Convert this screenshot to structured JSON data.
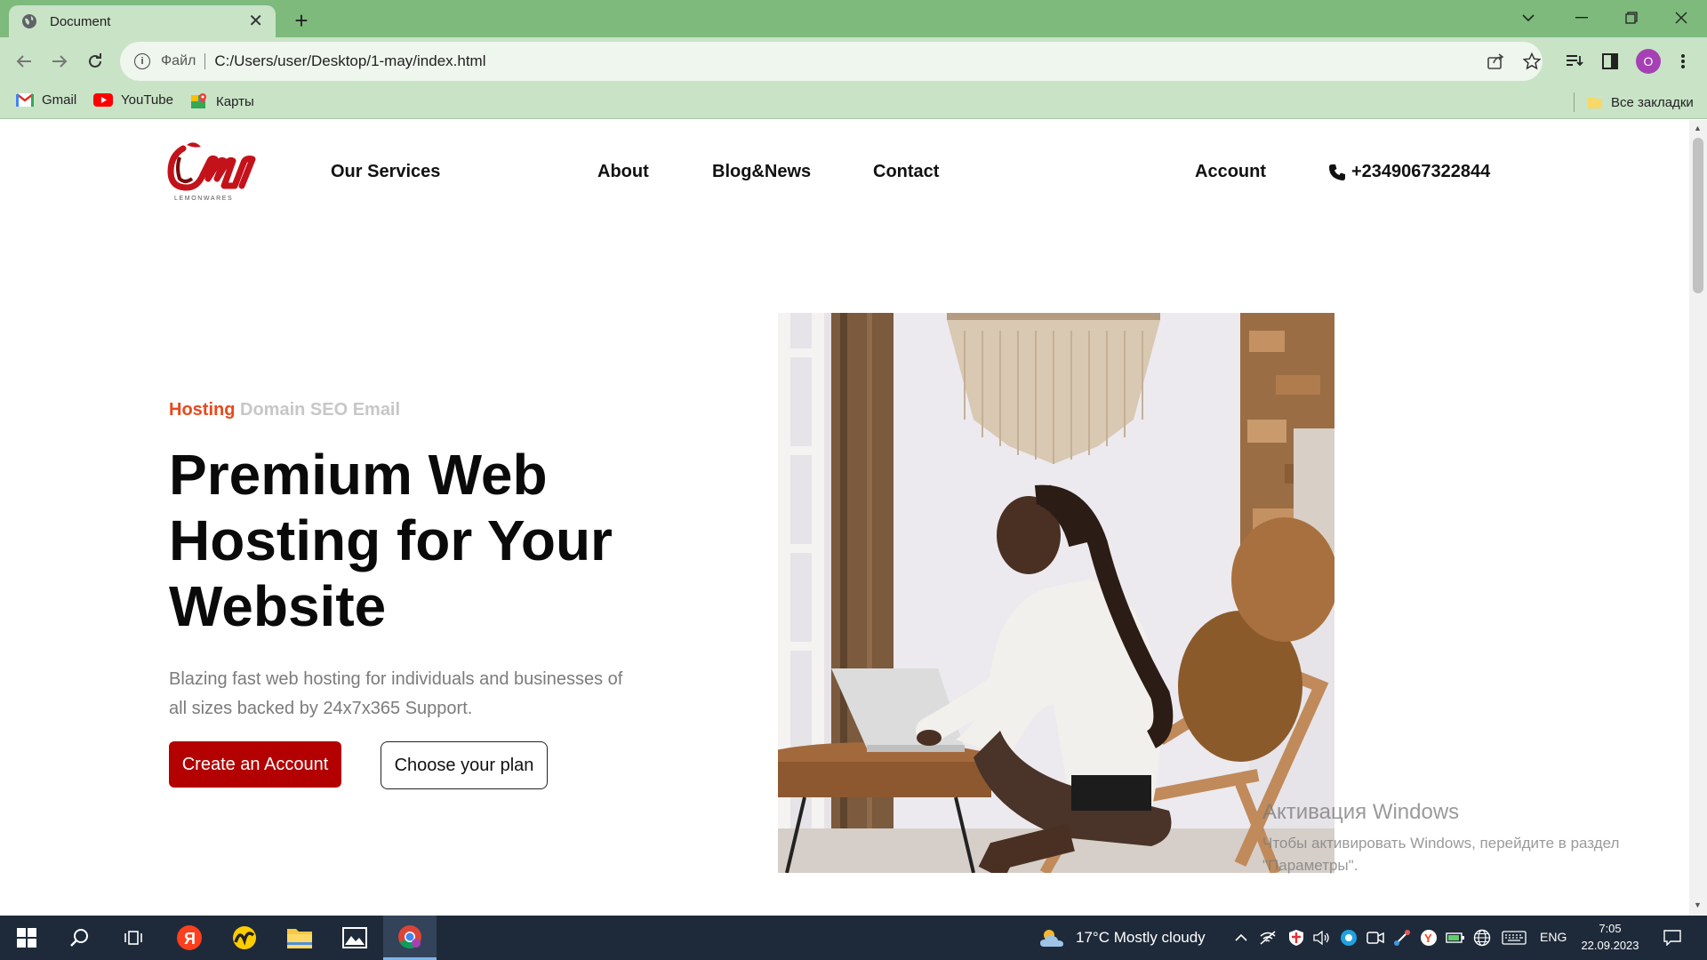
{
  "browser": {
    "tab_title": "Document",
    "address_scheme": "Файл",
    "address_url": "C:/Users/user/Desktop/1-may/index.html",
    "profile_initial": "O",
    "bookmarks": [
      "Gmail",
      "YouTube",
      "Карты"
    ],
    "all_bookmarks": "Все закладки"
  },
  "site": {
    "nav": {
      "services": "Our Services",
      "about": "About",
      "blog": "Blog&News",
      "contact": "Contact",
      "account": "Account",
      "phone": "+2349067322844"
    },
    "logo_text": "LEMONWARES",
    "hero": {
      "tag_active": "Hosting",
      "tag_rest": "Domain SEO Email",
      "title_line1": "Premium Web",
      "title_line2": "Hosting for Your",
      "title_line3": "Website",
      "subtitle": "Blazing fast web hosting for individuals and businesses of all sizes backed by 24x7x365 Support.",
      "cta_primary": "Create an Account",
      "cta_secondary": "Choose your plan"
    },
    "accent_color": "#b30000",
    "tag_color": "#e8491c"
  },
  "watermark": {
    "title": "Активация Windows",
    "subtitle": "Чтобы активировать Windows, перейдите в раздел \"Параметры\"."
  },
  "taskbar": {
    "weather": "17°C  Mostly cloudy",
    "lang": "ENG",
    "time": "7:05",
    "date": "22.09.2023"
  }
}
